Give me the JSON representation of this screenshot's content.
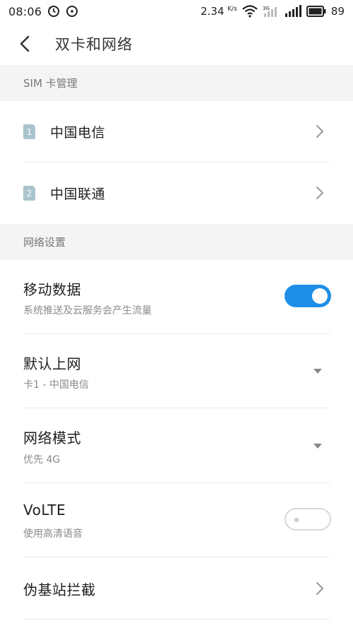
{
  "status_bar": {
    "time": "08:06",
    "speed_value": "2.34",
    "speed_unit": "K/s",
    "network_type": "3G",
    "battery": "89"
  },
  "header": {
    "title": "双卡和网络"
  },
  "sim_section": {
    "header": "SIM 卡管理",
    "cards": [
      {
        "badge": "1",
        "label": "中国电信"
      },
      {
        "badge": "2",
        "label": "中国联通"
      }
    ]
  },
  "network_section": {
    "header": "网络设置",
    "mobile_data": {
      "title": "移动数据",
      "subtitle": "系统推送及云服务会产生流量",
      "enabled": true
    },
    "default_network": {
      "title": "默认上网",
      "value": "卡1 - 中国电信"
    },
    "network_mode": {
      "title": "网络模式",
      "value": "优先 4G"
    },
    "volte": {
      "title": "VoLTE",
      "subtitle": "使用高清语音",
      "enabled": false
    },
    "fake_station": {
      "title": "伪基站拦截"
    }
  },
  "colors": {
    "accent": "#1e8ee8",
    "section_bg": "#f4f4f4",
    "sim_badge": "#a9c4cc"
  }
}
